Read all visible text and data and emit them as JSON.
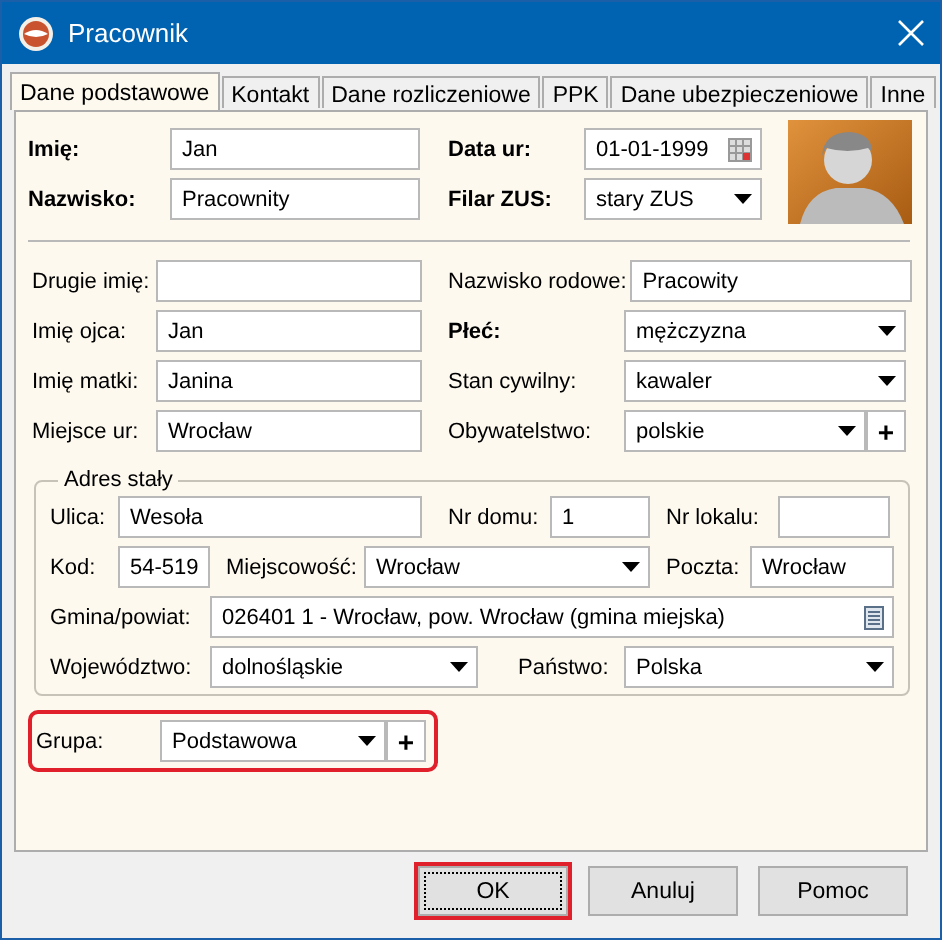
{
  "window": {
    "title": "Pracownik"
  },
  "tabs": [
    {
      "label": "Dane podstawowe",
      "selected": true
    },
    {
      "label": "Kontakt",
      "selected": false
    },
    {
      "label": "Dane rozliczeniowe",
      "selected": false
    },
    {
      "label": "PPK",
      "selected": false
    },
    {
      "label": "Dane ubezpieczeniowe",
      "selected": false
    },
    {
      "label": "Inne",
      "selected": false
    }
  ],
  "header_rows": [
    [
      {
        "label": "Imię:",
        "value": "Jan",
        "kind": "text",
        "required": true
      },
      {
        "label": "Data ur:",
        "value": "01-01-1999",
        "kind": "date",
        "required": true
      }
    ],
    [
      {
        "label": "Nazwisko:",
        "value": "Pracownity",
        "kind": "text",
        "required": true
      },
      {
        "label": "Filar ZUS:",
        "value": "stary ZUS",
        "kind": "combo",
        "required": true
      }
    ]
  ],
  "personal_rows": [
    [
      {
        "label": "Drugie imię:",
        "kind": "text",
        "required": false
      },
      {
        "label": "Nazwisko rodowe:",
        "value": "Pracowity",
        "kind": "text",
        "required": false
      }
    ],
    [
      {
        "label": "Imię ojca:",
        "value": "Jan",
        "kind": "text",
        "required": false
      },
      {
        "label": "Płeć:",
        "value": "mężczyzna",
        "kind": "combo",
        "required": true
      }
    ],
    [
      {
        "label": "Imię matki:",
        "value": "Janina",
        "kind": "text",
        "required": false
      },
      {
        "label": "Stan cywilny:",
        "value": "kawaler",
        "kind": "combo",
        "required": false
      }
    ],
    [
      {
        "label": "Miejsce ur:",
        "value": "Wrocław",
        "kind": "text",
        "required": false
      },
      {
        "label": "Obywatelstwo:",
        "value": "polskie",
        "kind": "combo",
        "required": false,
        "add_button": "+"
      }
    ]
  ],
  "address": {
    "legend": "Adres stały",
    "rows": [
      [
        {
          "label": "Ulica:",
          "value": "Wesoła",
          "kind": "text",
          "required": false
        },
        {
          "label": "Nr domu:",
          "value": "1",
          "kind": "text",
          "required": false
        },
        {
          "label": "Nr lokalu:",
          "kind": "text",
          "required": false
        }
      ],
      [
        {
          "label": "Kod:",
          "value": "54-519",
          "kind": "text",
          "required": false
        },
        {
          "label": "Miejscowość:",
          "value": "Wrocław",
          "kind": "combo",
          "required": false
        },
        {
          "label": "Poczta:",
          "value": "Wrocław",
          "kind": "text",
          "required": false
        }
      ],
      [
        {
          "label": "Gmina/powiat:",
          "value": "026401 1 - Wrocław, pow. Wrocław (gmina miejska)",
          "kind": "lookup",
          "required": false
        }
      ],
      [
        {
          "label": "Województwo:",
          "value": "dolnośląskie",
          "kind": "combo",
          "required": false
        },
        {
          "label": "Państwo:",
          "value": "Polska",
          "kind": "combo",
          "required": false
        }
      ]
    ]
  },
  "group": {
    "label": "Grupa:",
    "value": "Podstawowa",
    "kind": "combo",
    "required": false,
    "add_button": "+",
    "highlighted": true
  },
  "buttons": [
    {
      "label": "OK",
      "highlighted": true
    },
    {
      "label": "Anuluj",
      "highlighted": false
    },
    {
      "label": "Pomoc",
      "highlighted": false
    }
  ]
}
